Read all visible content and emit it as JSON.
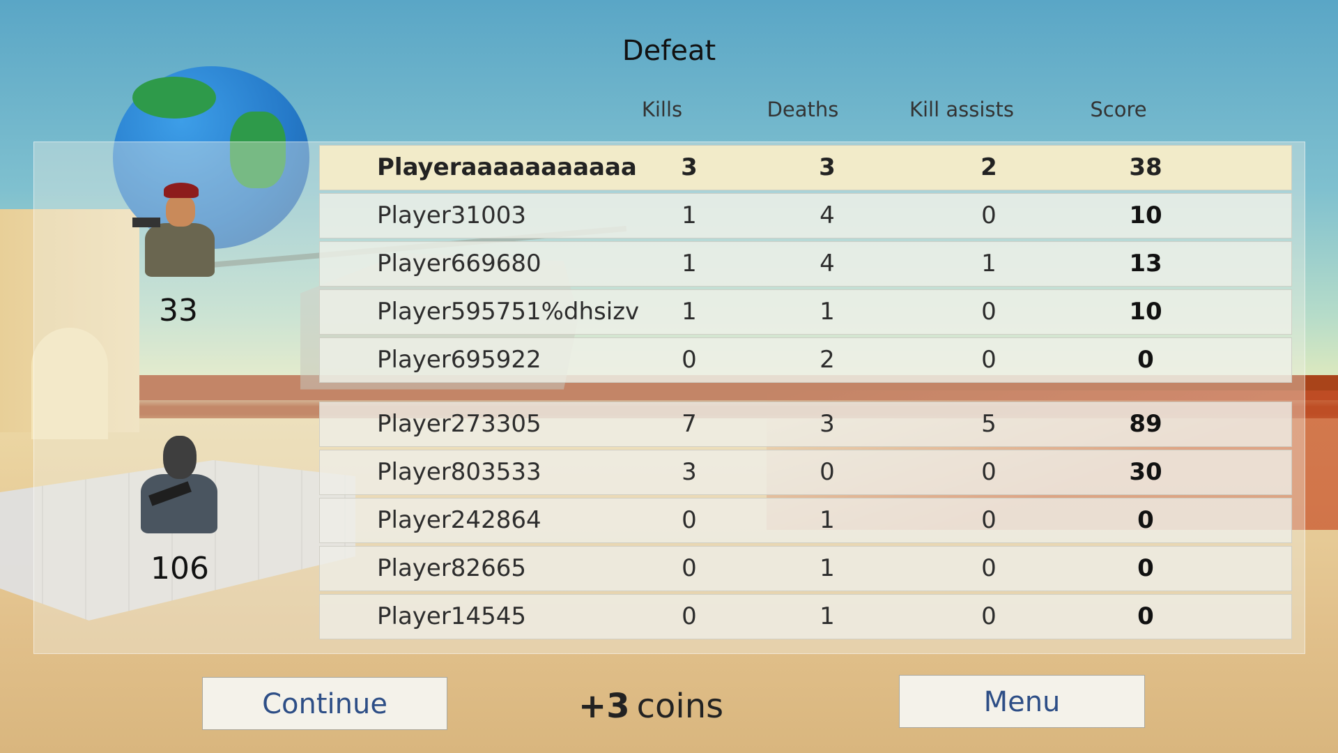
{
  "title": "Defeat",
  "headers": {
    "kills": "Kills",
    "deaths": "Deaths",
    "assists": "Kill assists",
    "score": "Score"
  },
  "team_a": {
    "score": "33",
    "players": [
      {
        "name": "Playeraaaaaaaaaaa",
        "kills": "3",
        "deaths": "3",
        "assists": "2",
        "score": "38"
      },
      {
        "name": "Player31003",
        "kills": "1",
        "deaths": "4",
        "assists": "0",
        "score": "10"
      },
      {
        "name": "Player669680",
        "kills": "1",
        "deaths": "4",
        "assists": "1",
        "score": "13"
      },
      {
        "name": "Player595751%dhsizv",
        "kills": "1",
        "deaths": "1",
        "assists": "0",
        "score": "10"
      },
      {
        "name": "Player695922",
        "kills": "0",
        "deaths": "2",
        "assists": "0",
        "score": "0"
      }
    ]
  },
  "team_b": {
    "score": "106",
    "players": [
      {
        "name": "Player273305",
        "kills": "7",
        "deaths": "3",
        "assists": "5",
        "score": "89"
      },
      {
        "name": "Player803533",
        "kills": "3",
        "deaths": "0",
        "assists": "0",
        "score": "30"
      },
      {
        "name": "Player242864",
        "kills": "0",
        "deaths": "1",
        "assists": "0",
        "score": "0"
      },
      {
        "name": "Player82665",
        "kills": "0",
        "deaths": "1",
        "assists": "0",
        "score": "0"
      },
      {
        "name": "Player14545",
        "kills": "0",
        "deaths": "1",
        "assists": "0",
        "score": "0"
      }
    ]
  },
  "reward": {
    "amount": "+3",
    "unit": "coins"
  },
  "buttons": {
    "continue": "Continue",
    "menu": "Menu"
  },
  "colors": {
    "button_text": "#2d4e86",
    "highlight_row": "#f6ecc8"
  }
}
